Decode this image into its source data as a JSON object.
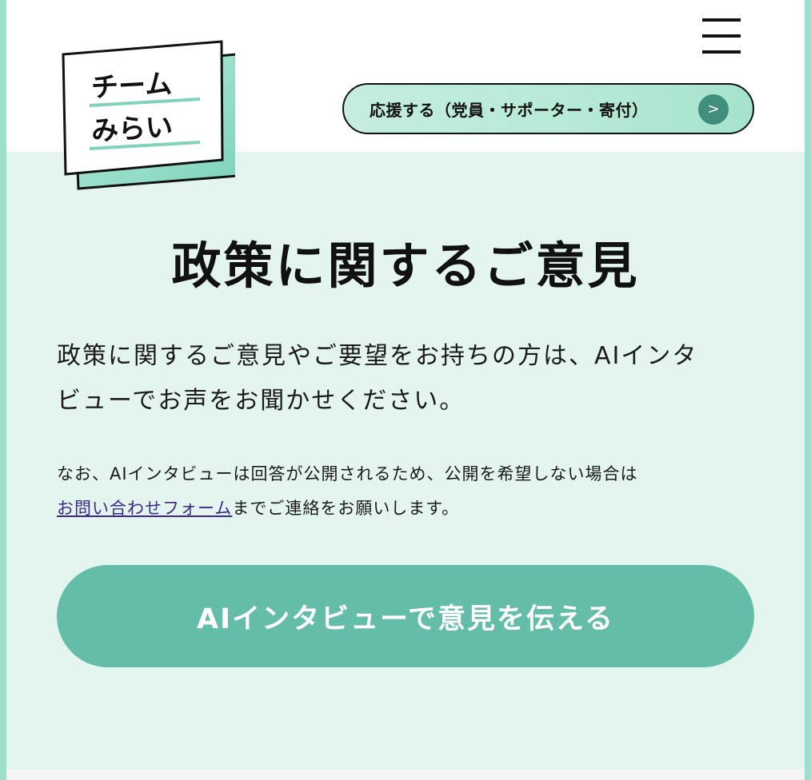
{
  "header": {
    "logo_lines": [
      "チーム",
      "みらい"
    ],
    "support_label": "応援する（党員・サポーター・寄付）",
    "support_arrow": ">"
  },
  "main": {
    "title": "政策に関するご意見",
    "lead_line1": "政策に関するご意見やご要望をお持ちの方は、AIインタ",
    "lead_line2": "ビューでお声をお聞かせください。",
    "note_line1": "なお、AIインタビューは回答が公開されるため、公開を希望しない場合は",
    "note_link": "お問い合わせフォーム",
    "note_after_link": "までご連絡をお願いします。",
    "cta_label": "AIインタビューで意見を伝える"
  },
  "colors": {
    "accent": "#64bda9",
    "background": "#e4f5ef",
    "border": "#9ddfcc",
    "link": "#3b2a8c",
    "arrow_circle": "#3f8f7c"
  },
  "icons": {
    "menu": "hamburger-menu-icon",
    "arrow": "chevron-right-icon"
  }
}
